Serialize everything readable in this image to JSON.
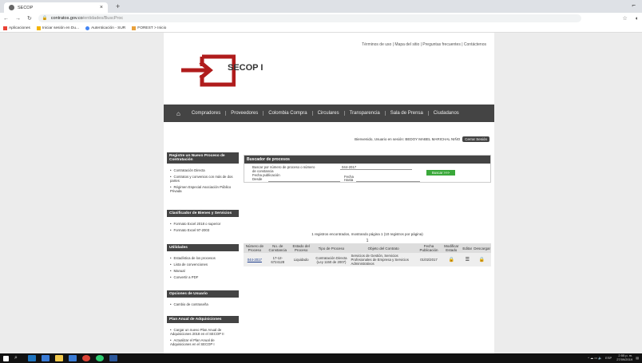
{
  "browser": {
    "tab_title": "SECOP",
    "tab_close": "×",
    "new_tab": "+",
    "url_host": "contratos.gov.co",
    "url_path": "/entidades/BuscProc",
    "bookmarks": [
      "Aplicaciones",
      "Iniciar sesión en Du...",
      "Autenticación - SUR",
      "FOREST > Inicio"
    ]
  },
  "header": {
    "top_links": "Términos de uso | Mapa del sitio | Preguntas frecuentes | Contáctenos",
    "logo_text": "SECOP I"
  },
  "nav": {
    "items": [
      "Compradores",
      "Proveedores",
      "Colombia Compra",
      "Circulares",
      "Transparencia",
      "Sala de Prensa",
      "Ciudadanos"
    ]
  },
  "welcome": {
    "text": "Bienvenido, Usuario en sesión: BEDOY MABEL MARICHAL NIÑO",
    "logout": "Cerrar Sesión"
  },
  "sidebar": {
    "sections": [
      {
        "title": "Registre un Nuevo Proceso de Contratación",
        "items": [
          "Contratación Directa",
          "Contratos y convenios con más de dos partes",
          "Régimen Especial Asociación Público Privada"
        ]
      },
      {
        "title": "Clasificador de Bienes y Servicios",
        "items": [
          "Formato Excel 2018 o superior",
          "Formato Excel 97-2003"
        ]
      },
      {
        "title": "Utilidades",
        "items": [
          "Estadística de los procesos",
          "Lista de convenciones",
          "Manual",
          "Convertir a PDF"
        ]
      },
      {
        "title": "Opciones de Usuario",
        "items": [
          "Cambio de contraseña"
        ]
      },
      {
        "title": "Plan Anual de Adquisiciones",
        "items": [
          "Cargar un nuevo Plan Anual de Adquisiciones 2018 en el SECOP II",
          "Actualizar el Plan Anual de Adquisiciones en el SECOP I"
        ]
      }
    ]
  },
  "search": {
    "title": "Buscador de procesos",
    "field_label": "Buscar por número de proceso o número de constancia",
    "field_value": "044-2017",
    "pub_label": "Fecha publicación",
    "from_label": "Desde",
    "to_label": "Hasta",
    "fecha_label": "Fecha",
    "button": "Buscar >>>"
  },
  "results": {
    "summary": "1 registros encontrados, mostrando página 1 (10 registros por página)",
    "page": "1",
    "headers": [
      "Número de Proceso",
      "No. de Constancia",
      "Estado del Proceso",
      "Tipo de Proceso",
      "Objeto del Contrato",
      "Fecha Publicación",
      "Modificar Estado",
      "Editar",
      "Descargar"
    ],
    "rows": [
      {
        "proceso": "044-2017",
        "constancia": "17-12-6724128",
        "estado": "Liquidado",
        "tipo": "Contratación Directa (Ley 1150 de 2007)",
        "objeto": "Servicios de Gestión, Servicios Profesionales de Empresa y Servicios Administrativos",
        "fecha": "01/02/2017"
      }
    ]
  },
  "taskbar": {
    "time": "2:55 p. m.",
    "date": "27/09/2019",
    "lang": "ESP"
  }
}
